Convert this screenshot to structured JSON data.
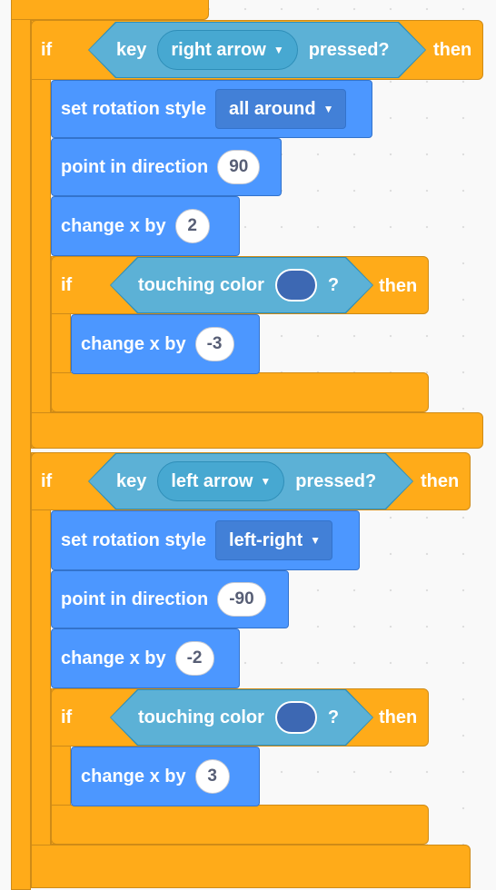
{
  "colors": {
    "control": "#ffab19",
    "motion": "#4c97ff",
    "sensing": "#5cb1d6",
    "touch_swatch": "#3d68b3"
  },
  "script": {
    "block1": {
      "if_label": "if",
      "then_label": "then",
      "condition": {
        "pre": "key",
        "key": "right arrow",
        "post": "pressed?"
      },
      "rotation": {
        "label": "set rotation style",
        "value": "all around"
      },
      "direction": {
        "label": "point in direction",
        "value": "90"
      },
      "change": {
        "label": "change x by",
        "value": "2"
      },
      "inner_if": {
        "if_label": "if",
        "then_label": "then",
        "condition": {
          "label": "touching color",
          "q": "?"
        },
        "change": {
          "label": "change x by",
          "value": "-3"
        }
      }
    },
    "block2": {
      "if_label": "if",
      "then_label": "then",
      "condition": {
        "pre": "key",
        "key": "left arrow",
        "post": "pressed?"
      },
      "rotation": {
        "label": "set rotation style",
        "value": "left-right"
      },
      "direction": {
        "label": "point in direction",
        "value": "-90"
      },
      "change": {
        "label": "change x by",
        "value": "-2"
      },
      "inner_if": {
        "if_label": "if",
        "then_label": "then",
        "condition": {
          "label": "touching color",
          "q": "?"
        },
        "change": {
          "label": "change x by",
          "value": "3"
        }
      }
    }
  }
}
